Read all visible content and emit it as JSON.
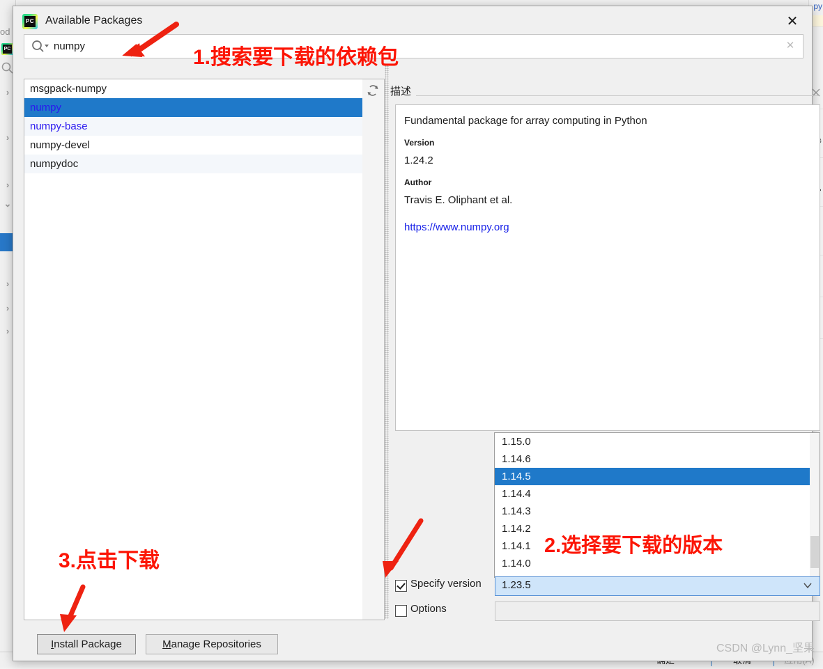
{
  "background": {
    "left_label": "od",
    "right_tab_icons": [
      "close-icon",
      "gear-icon",
      "plus-icon",
      "collapse-icon",
      "refresh-icon",
      "settings-icon"
    ],
    "right_code_fragment": "py",
    "bottom_buttons": [
      "确定",
      "取消",
      "应用(A)"
    ]
  },
  "dialog": {
    "title": "Available Packages",
    "close_label": "✕",
    "search": {
      "value": "numpy",
      "placeholder": "",
      "clear_label": "✕",
      "icon": "search-icon"
    },
    "packages": [
      {
        "name": "msgpack-numpy",
        "selected": false,
        "link": false
      },
      {
        "name": "numpy",
        "selected": true,
        "link": true
      },
      {
        "name": "numpy-base",
        "selected": false,
        "link": true
      },
      {
        "name": "numpy-devel",
        "selected": false,
        "link": false
      },
      {
        "name": "numpydoc",
        "selected": false,
        "link": false
      }
    ],
    "refresh_icon": "refresh-icon",
    "description": {
      "section_label": "描述",
      "summary": "Fundamental package for array computing in Python",
      "version_label": "Version",
      "version_value": "1.24.2",
      "author_label": "Author",
      "author_value": "Travis E. Oliphant et al.",
      "url": "https://www.numpy.org"
    },
    "version_list": {
      "items": [
        "1.15.0",
        "1.14.6",
        "1.14.5",
        "1.14.4",
        "1.14.3",
        "1.14.2",
        "1.14.1",
        "1.14.0"
      ],
      "selected": "1.14.5"
    },
    "specify_version": {
      "label": "Specify version",
      "checked": true,
      "selected_value": "1.23.5"
    },
    "options": {
      "label": "Options",
      "checked": false,
      "value": ""
    },
    "buttons": {
      "install_mnemonic": "I",
      "install_rest": "nstall Package",
      "manage_mnemonic": "M",
      "manage_rest": "anage Repositories"
    }
  },
  "annotations": [
    {
      "id": "step-1",
      "text": "1.搜索要下载的依赖包",
      "color": "#fc1505"
    },
    {
      "id": "step-2",
      "text": "2.选择要下载的版本",
      "color": "#fc1505"
    },
    {
      "id": "step-3",
      "text": "3.点击下载",
      "color": "#fc1505"
    }
  ],
  "watermark": "CSDN @Lynn_坚果",
  "colors": {
    "selection_blue": "#1f79c9",
    "link_blue": "#2b1af0",
    "annotation_red": "#fc1505",
    "combo_blue": "#cfe5fa"
  }
}
